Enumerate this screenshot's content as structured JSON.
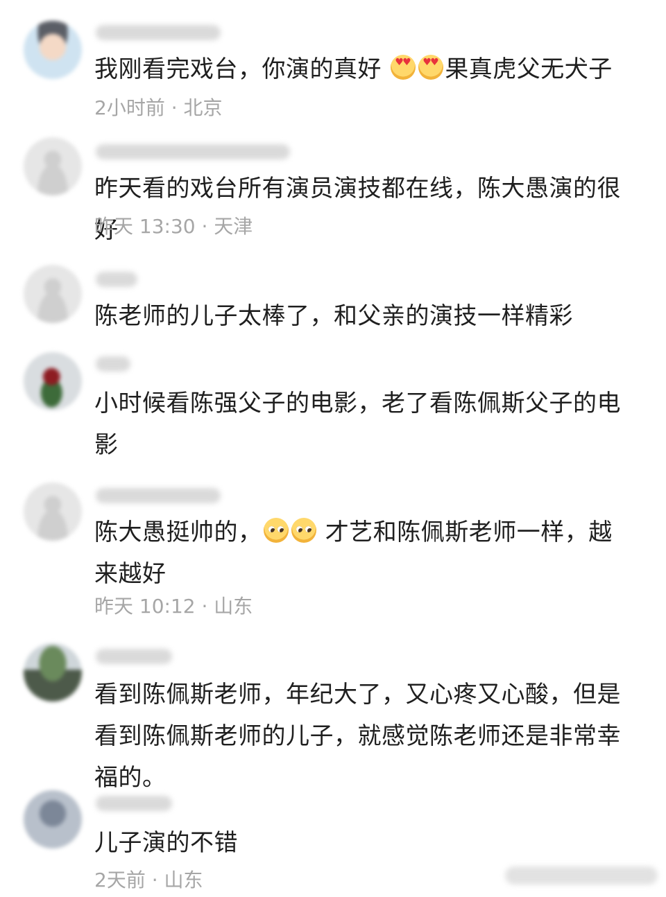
{
  "comments": [
    {
      "avatar": "avatar-face",
      "segments": [
        "我刚看完戏台，你演的真好 ",
        "heart-eyes-emoji",
        "heart-eyes-emoji",
        "果真虎父无犬子"
      ],
      "meta": "2小时前 · 北京"
    },
    {
      "avatar": "avatar-default",
      "text": "昨天看的戏台所有演员演技都在线，陈大愚演的很好",
      "meta": "昨天 13:30 · 天津"
    },
    {
      "avatar": "avatar-default",
      "text": "陈老师的儿子太棒了，和父亲的演技一样精彩",
      "meta": ""
    },
    {
      "avatar": "avatar-rose",
      "text": "小时候看陈强父子的电影，老了看陈佩斯父子的电影",
      "meta": ""
    },
    {
      "avatar": "avatar-default",
      "segments": [
        "陈大愚挺帅的，",
        "pleading-face-emoji",
        "pleading-face-emoji",
        " 才艺和陈佩斯老师一样，越来越好"
      ],
      "meta": "昨天 10:12 · 山东"
    },
    {
      "avatar": "avatar-trees",
      "text": "看到陈佩斯老师，年纪大了，又心疼又心酸，但是看到陈佩斯老师的儿子，就感觉陈老师还是非常幸福的。",
      "meta": ""
    },
    {
      "avatar": "avatar-dark",
      "text": "儿子演的不错",
      "meta": "2天前 · 山东"
    }
  ]
}
